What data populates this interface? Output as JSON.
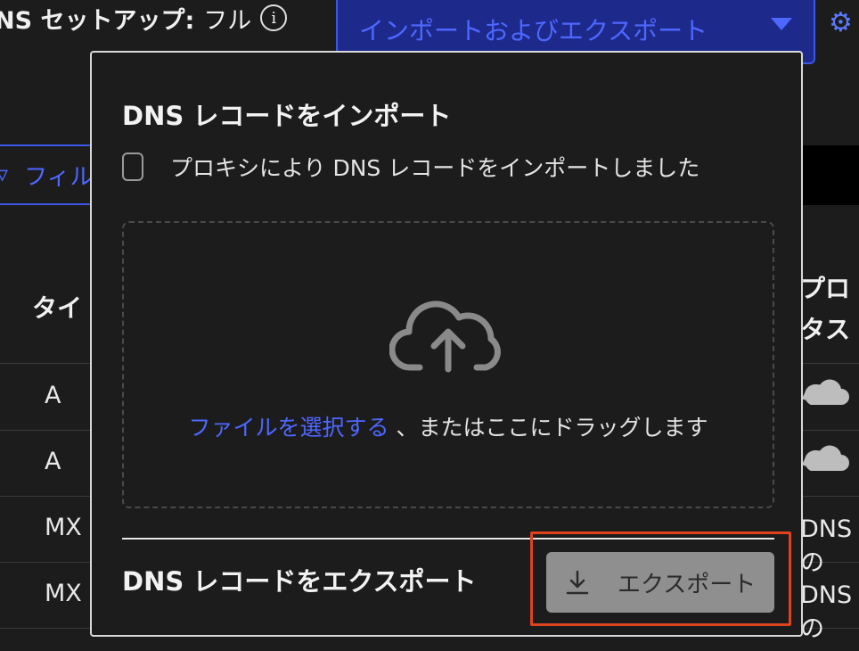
{
  "header": {
    "dns_setup_label": "NS セットアップ:",
    "dns_setup_value": "フル",
    "info_glyph": "i",
    "import_export_label": "インポートおよびエクスポート",
    "settings_glyph": "⚙"
  },
  "toolbar": {
    "filter_label": "フィル",
    "filter_glyph": "▿"
  },
  "table": {
    "col_type": "タイ",
    "col_proxy_line1": "プロ",
    "col_proxy_line2": "タス",
    "rows": [
      {
        "type": "A",
        "proxy_text": ""
      },
      {
        "type": "A",
        "proxy_text": ""
      },
      {
        "type": "MX",
        "proxy_text": "DNS の"
      },
      {
        "type": "MX",
        "proxy_text": "DNS の"
      }
    ]
  },
  "popover": {
    "import_title": "DNS レコードをインポート",
    "proxy_checkbox_label": "プロキシにより DNS レコードをインポートしました",
    "proxy_checkbox_checked": false,
    "dropzone_link": "ファイルを選択する",
    "dropzone_text": "、またはここにドラッグします",
    "export_title": "DNS レコードをエクスポート",
    "export_button_label": "エクスポート"
  },
  "icons": {
    "info": "info-circle-icon",
    "caret": "caret-down-icon",
    "gear": "gear-icon",
    "filter": "filter-icon",
    "upload": "cloud-upload-icon",
    "download": "download-icon",
    "proxied": "proxied-cloud-icon"
  },
  "colors": {
    "accent": "#4e67ff",
    "highlight": "#e0421e",
    "background": "#1c1c1d"
  }
}
